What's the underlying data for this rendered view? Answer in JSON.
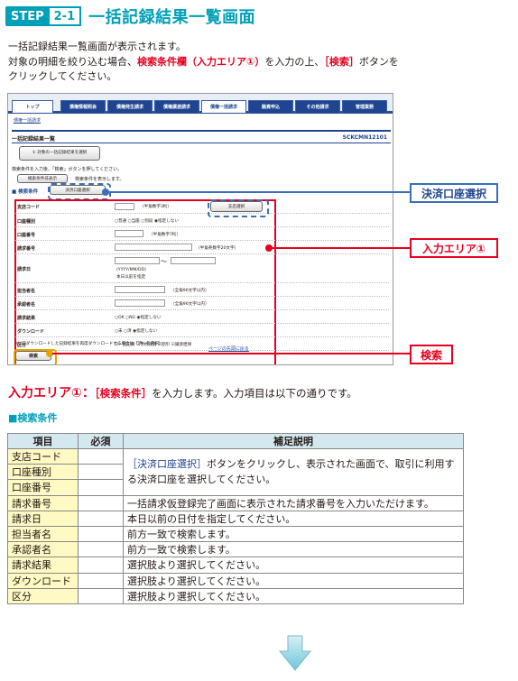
{
  "header": {
    "step_label": "STEP",
    "step_number": "2-1",
    "title": "一括記録結果一覧画面"
  },
  "intro": {
    "line1": "一括記録結果一覧画面が表示されます。",
    "line2_prefix": "対象の明細を絞り込む場合、",
    "line2_red1": "検索条件欄（入力エリア①）",
    "line2_mid": "を入力の上、",
    "line2_red2": "［検索］",
    "line2_suffix": "ボタンを",
    "line3": "クリックしてください。"
  },
  "screen": {
    "tabs": [
      "トップ",
      "債権情報照会",
      "債権発生請求",
      "債権譲渡請求",
      "債権一括請求",
      "融資申込",
      "その他請求",
      "管理業務"
    ],
    "breadcrumb": "債権一括請求",
    "page_heading": "一括記録結果一覧",
    "screen_id": "SCKCMN12101",
    "object_button": "① 対象の一括記録結果を選択",
    "message": "検索条件を入力後、「検索」ボタンを押してください。",
    "toggle_button": "検索条件非表示",
    "toggle_message": "検索条件を表示します。",
    "section_heading": "■ 検索条件",
    "account_button": "決済口座選択",
    "branch_button": "支店選択",
    "fields": [
      {
        "label": "支店コード",
        "note": "（半角数字3桁）"
      },
      {
        "label": "口座種別",
        "note": "○普通 ○当座 ○別段 ◉指定しない"
      },
      {
        "label": "口座番号",
        "note": "（半角数字7桁）"
      },
      {
        "label": "請求番号",
        "note": "（半角英数字20文字）"
      },
      {
        "label": "請求日",
        "note": "(YYYY/MM/DD)",
        "note2": "本日以前を指定",
        "range": "～"
      },
      {
        "label": "担当者名",
        "note": "（全角96文字以内）"
      },
      {
        "label": "承認者名",
        "note": "（全角96文字以内）"
      },
      {
        "label": "請求結果",
        "note": "○OK ○NG ◉指定しない"
      },
      {
        "label": "ダウンロード",
        "note": "○未 ○済 ◉指定しない"
      },
      {
        "label": "区分",
        "note": "☑一括記録 ☑予約取消 ☑割引 ☑譲渡担保"
      }
    ],
    "redo_note": "（以前ダウンロードした記録結果を再度ダウンロードする場合は「済」を選択）",
    "back_link": "ページの先頭に戻る",
    "search_button": "検索"
  },
  "callouts": {
    "account": "決済口座選択",
    "input_area": "入力エリア①",
    "search": "検索"
  },
  "section2": {
    "heading_red": "入力エリア①：",
    "heading_red2": "［検索条件］",
    "heading_rest": "を入力します。入力項目は以下の通りです。",
    "subheading": "■検索条件"
  },
  "table": {
    "headers": [
      "項目",
      "必須",
      "補足説明"
    ],
    "merged_note_link": "［決済口座選択］",
    "merged_note_rest": "ボタンをクリックし、表示された画面で、取引に利用する決済口座を選択してください。",
    "rows": [
      {
        "item": "支店コード",
        "note": ""
      },
      {
        "item": "口座種別",
        "note": ""
      },
      {
        "item": "口座番号",
        "note": ""
      },
      {
        "item": "請求番号",
        "note": "一括請求仮登録完了画面に表示された請求番号を入力いただけます。"
      },
      {
        "item": "請求日",
        "note": "本日以前の日付を指定してください。"
      },
      {
        "item": "担当者名",
        "note": "前方一致で検索します。"
      },
      {
        "item": "承認者名",
        "note": "前方一致で検索します。"
      },
      {
        "item": "請求結果",
        "note": "選択肢より選択してください。"
      },
      {
        "item": "ダウンロード",
        "note": "選択肢より選択してください。"
      },
      {
        "item": "区分",
        "note": "選択肢より選択してください。"
      }
    ]
  },
  "colors": {
    "teal": "#00a0b8",
    "red": "#e6001e",
    "navy": "#1f4591",
    "yellow_required": "#fff9c4",
    "header_cell": "#d4e8ef"
  }
}
